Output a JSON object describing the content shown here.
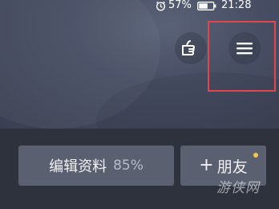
{
  "status_bar": {
    "battery_pct": "57%",
    "time": "21:28",
    "icons": [
      "alarm-icon",
      "battery-icon"
    ]
  },
  "header": {
    "icons": [
      "hand-pointer-icon",
      "hamburger-menu-icon"
    ],
    "highlight_color": "#e0474c"
  },
  "actions": {
    "edit_profile_label": "编辑资料",
    "profile_completion": "85%",
    "add_friend_plus": "+",
    "add_friend_label": "朋友",
    "notification_dot_color": "#f5c84c"
  },
  "watermark": "游侠网"
}
